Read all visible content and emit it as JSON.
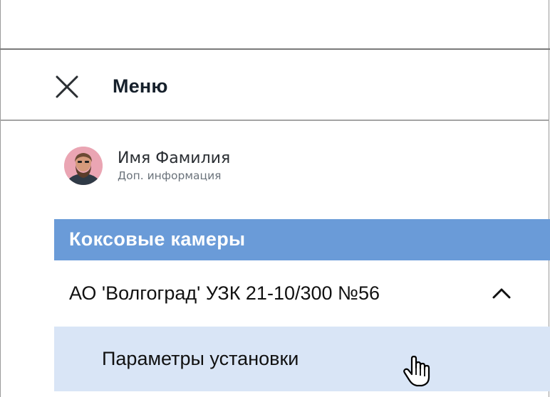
{
  "header": {
    "title": "Меню",
    "close_icon": "close-icon"
  },
  "user": {
    "name": "Имя Фамилия",
    "info": "Доп. информация",
    "avatar_icon": "avatar"
  },
  "menu": {
    "section_title": "Коксовые камеры",
    "group": {
      "label": "АО 'Волгоград' УЗК 21-10/300 №56",
      "expanded": true,
      "chevron_icon": "chevron-up-icon"
    },
    "items": [
      {
        "label": "Параметры установки",
        "hovered": true
      }
    ]
  },
  "cursor_icon": "hand-pointer-icon",
  "colors": {
    "section_bg": "#6a9bd8",
    "hover_bg": "#d9e5f6",
    "title_text": "#16202b",
    "section_text": "#ffffff",
    "secondary_text": "#6b737b"
  }
}
